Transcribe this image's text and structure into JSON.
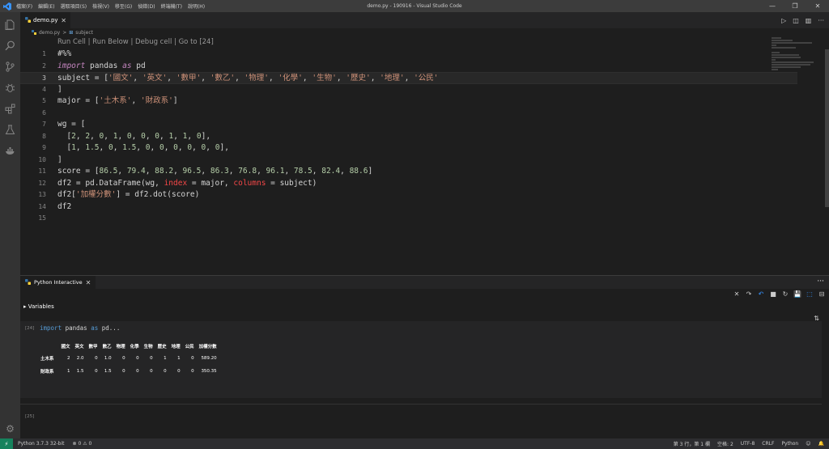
{
  "titlebar": {
    "menus": [
      "檔案(F)",
      "編輯(E)",
      "選取項目(S)",
      "檢視(V)",
      "移至(G)",
      "偵錯(D)",
      "終端機(T)",
      "說明(H)"
    ],
    "title": "demo.py - 190916 - Visual Studio Code",
    "min": "—",
    "restore": "❐",
    "close": "✕"
  },
  "tab": {
    "label": "demo.py",
    "close": "✕"
  },
  "tab_actions": {
    "run": "▷",
    "split": "◫",
    "layout": "▥",
    "more": "···"
  },
  "breadcrumb": {
    "file": "demo.py",
    "sep": ">",
    "symbol_icon": "⊞",
    "symbol": "subject"
  },
  "codelens": {
    "run_cell": "Run Cell",
    "sep1": " | ",
    "run_below": "Run Below",
    "sep2": " | ",
    "debug_cell": "Debug cell",
    "sep3": " | ",
    "goto": "Go to [24]"
  },
  "code": {
    "l1": "#%%",
    "l2_kw1": "import",
    "l2_mid": " pandas ",
    "l2_kw2": "as",
    "l2_end": " pd",
    "l3_a": "subject = [",
    "l3_items": [
      "'國文'",
      "'英文'",
      "'數甲'",
      "'數乙'",
      "'物理'",
      "'化學'",
      "'生物'",
      "'歷史'",
      "'地理'",
      "'公民'"
    ],
    "l3_b": "]",
    "l4": "]",
    "l5_a": "major = [",
    "l5_items": [
      "'土木系'",
      "'財政系'"
    ],
    "l5_b": "]",
    "l7": "wg = [",
    "l8": [
      "2",
      "2",
      "0",
      "1",
      "0",
      "0",
      "0",
      "1",
      "1",
      "0"
    ],
    "l9": [
      "1",
      "1.5",
      "0",
      "1.5",
      "0",
      "0",
      "0",
      "0",
      "0",
      "0"
    ],
    "l10": "]",
    "l11_a": "score = [",
    "l11": [
      "86.5",
      "79.4",
      "88.2",
      "96.5",
      "86.3",
      "76.8",
      "96.1",
      "78.5",
      "82.4",
      "88.6"
    ],
    "l11_b": "]",
    "l12_a": "df2 = pd.DataFrame(wg, ",
    "l12_p1": "index",
    "l12_b": " = major, ",
    "l12_p2": "columns",
    "l12_c": " = subject)",
    "l13_a": "df2[",
    "l13_str": "'加權分數'",
    "l13_b": "] = df2.dot(score)",
    "l14": "df2",
    "line_numbers": [
      "1",
      "2",
      "3",
      "4",
      "5",
      "6",
      "7",
      "8",
      "9",
      "10",
      "11",
      "12",
      "13",
      "14",
      "15"
    ]
  },
  "panel": {
    "tab_label": "Python Interactive",
    "tab_close": "✕",
    "more": "···",
    "toolbar": {
      "clear": "✕",
      "redo": "↷",
      "undo": "↶",
      "stop": "■",
      "restart": "↻",
      "save": "💾",
      "export": "⬚",
      "collapse": "⊟"
    },
    "variables_label": "Variables",
    "variables_arrow": "▸",
    "collapse_icon": "⇅",
    "cell_number": "[24]",
    "cell_code_kw": "import",
    "cell_code_rest": " pandas ",
    "cell_code_kw2": "as",
    "cell_code_end": " pd...",
    "input_cell_number": "[25]"
  },
  "dataframe": {
    "columns": [
      "國文",
      "英文",
      "數甲",
      "數乙",
      "物理",
      "化學",
      "生物",
      "歷史",
      "地理",
      "公民",
      "加權分數"
    ],
    "rows": [
      {
        "index": "土木系",
        "values": [
          "2",
          "2.0",
          "0",
          "1.0",
          "0",
          "0",
          "0",
          "1",
          "1",
          "0",
          "589.20"
        ]
      },
      {
        "index": "財政系",
        "values": [
          "1",
          "1.5",
          "0",
          "1.5",
          "0",
          "0",
          "0",
          "0",
          "0",
          "0",
          "350.35"
        ]
      }
    ]
  },
  "statusbar": {
    "remote": "⚡",
    "python": "Python 3.7.3 32-bit",
    "errors": "⊗ 0",
    "warnings": "⚠ 0",
    "position": "第 3 行，第 1 欄",
    "spaces": "空格: 2",
    "encoding": "UTF-8",
    "eol": "CRLF",
    "language": "Python",
    "feedback": "☺",
    "bell": "🔔"
  }
}
